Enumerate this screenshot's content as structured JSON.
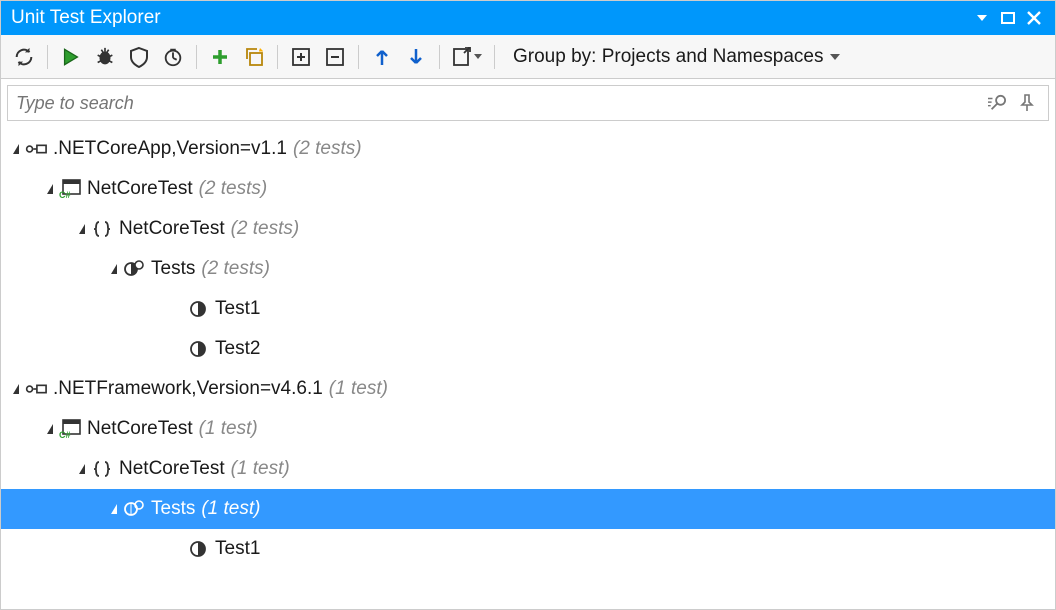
{
  "window": {
    "title": "Unit Test Explorer"
  },
  "search": {
    "placeholder": "Type to search"
  },
  "groupby": {
    "label": "Group by: Projects and Namespaces"
  },
  "tree": {
    "g0": {
      "label": ".NETCoreApp,Version=v1.1",
      "count": "(2 tests)"
    },
    "g0p": {
      "label": "NetCoreTest",
      "count": "(2 tests)"
    },
    "g0n": {
      "label": "NetCoreTest",
      "count": "(2 tests)"
    },
    "g0c": {
      "label": "Tests",
      "count": "(2 tests)"
    },
    "g0t1": {
      "label": "Test1"
    },
    "g0t2": {
      "label": "Test2"
    },
    "g1": {
      "label": ".NETFramework,Version=v4.6.1",
      "count": "(1 test)"
    },
    "g1p": {
      "label": "NetCoreTest",
      "count": "(1 test)"
    },
    "g1n": {
      "label": "NetCoreTest",
      "count": "(1 test)"
    },
    "g1c": {
      "label": "Tests",
      "count": "(1 test)"
    },
    "g1t1": {
      "label": "Test1"
    }
  }
}
